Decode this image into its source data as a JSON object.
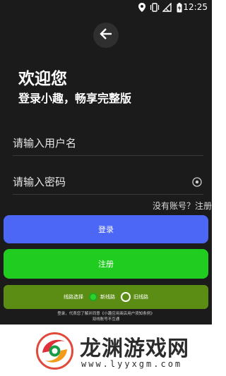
{
  "status_bar": {
    "time": "12:25",
    "icons": [
      "location-icon",
      "vibrate-icon",
      "no-signal-icon",
      "battery-charging-icon"
    ]
  },
  "header": {
    "back_icon": "arrow-left-icon",
    "title": "欢迎您",
    "subtitle": "登录小趣，畅享完整版"
  },
  "form": {
    "username_placeholder": "请输入用户名",
    "password_placeholder": "请输入密码",
    "password_icon": "eye-icon",
    "register_link": "没有账号？注册"
  },
  "buttons": {
    "login": "登录",
    "register": "注册"
  },
  "line_select": {
    "label": "线路选择",
    "new_line": "新线路",
    "old_line": "旧线路",
    "selected": "新线路"
  },
  "footer": {
    "note1": "登录，代表您了解并同意《小趣应用商店用户须知条例》",
    "note2": "双线账号不互通"
  },
  "watermark": {
    "title": "龙渊游戏网",
    "url": "www.lyyxgm.com"
  },
  "colors": {
    "background": "#1b1b1b",
    "login_button": "#4c67f5",
    "register_button": "#20cc20",
    "line_panel": "#5b8d14"
  }
}
